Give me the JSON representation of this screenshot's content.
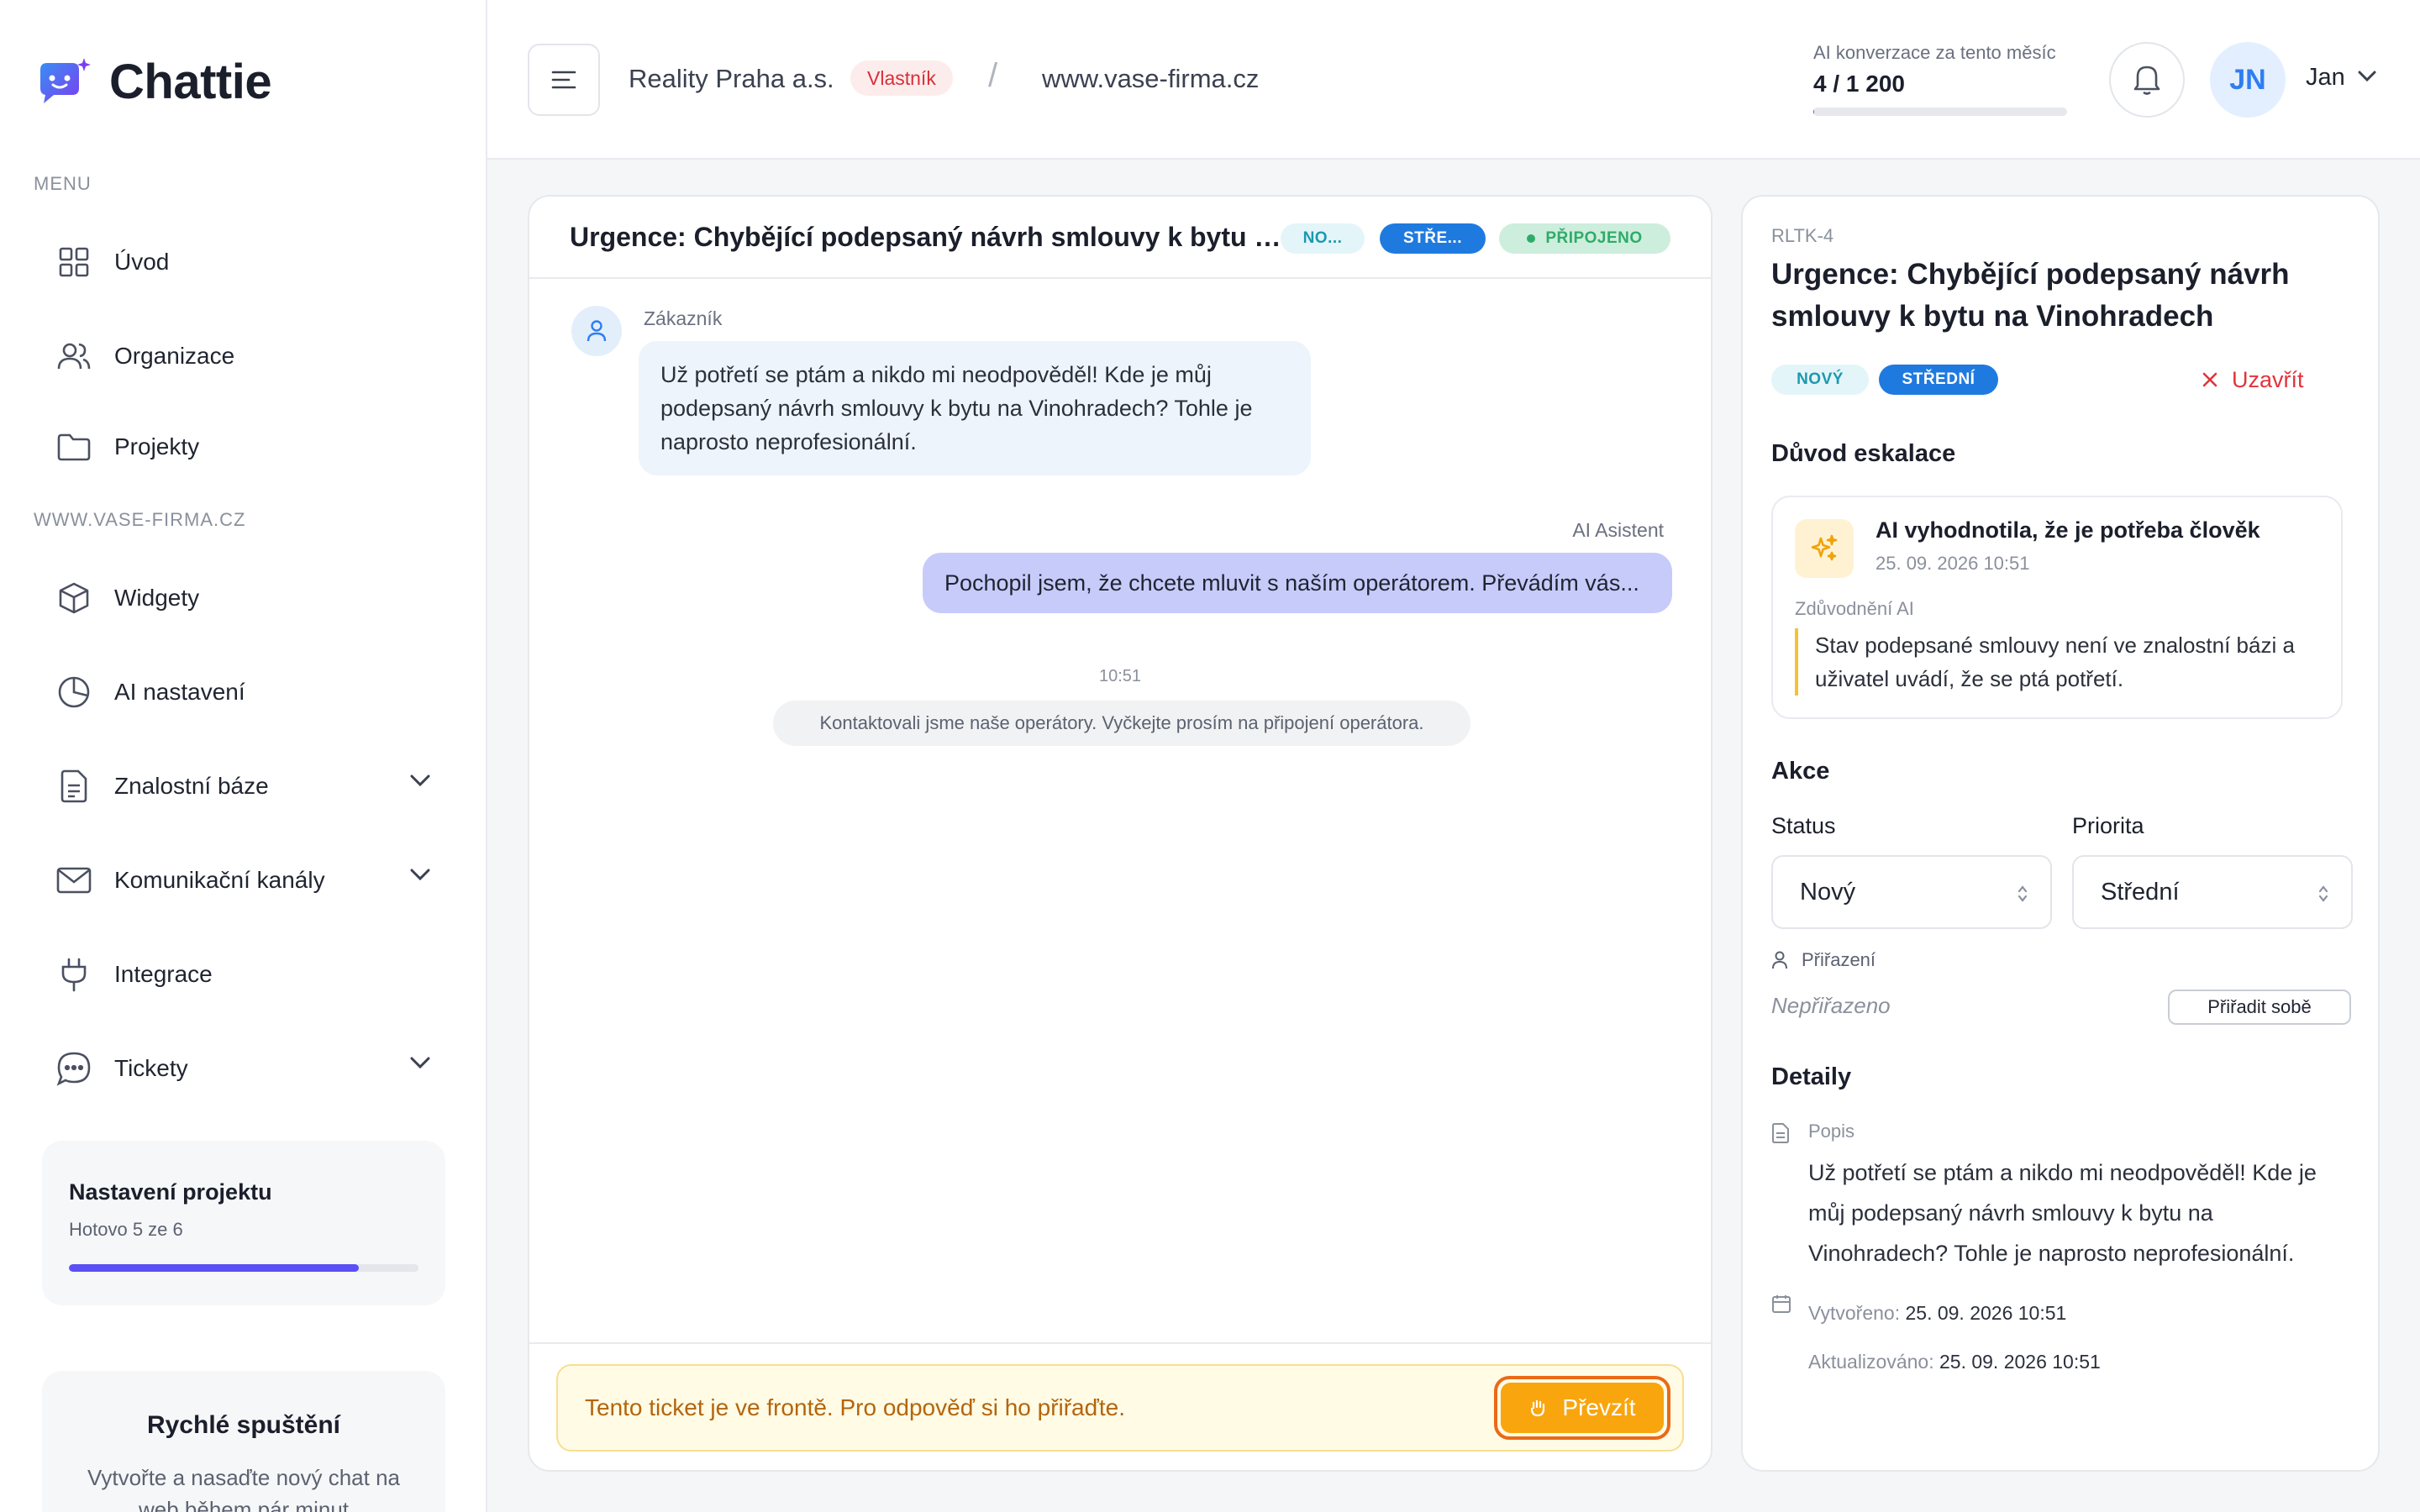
{
  "sidebar": {
    "brand": "Chattie",
    "menu_label": "MENU",
    "project_label": "WWW.VASE-FIRMA.CZ",
    "items": [
      {
        "label": "Úvod",
        "icon": "grid-icon"
      },
      {
        "label": "Organizace",
        "icon": "users-icon"
      },
      {
        "label": "Projekty",
        "icon": "folder-icon"
      }
    ],
    "project_items": [
      {
        "label": "Widgety",
        "icon": "cube-icon"
      },
      {
        "label": "AI nastavení",
        "icon": "pie-chart-icon"
      },
      {
        "label": "Znalostní báze",
        "icon": "document-icon"
      },
      {
        "label": "Komunikační kanály",
        "icon": "mail-icon"
      },
      {
        "label": "Integrace",
        "icon": "plug-icon"
      },
      {
        "label": "Tickety",
        "icon": "chat-bubble-icon"
      }
    ],
    "setup_card": {
      "title": "Nastavení projektu",
      "progress_text": "Hotovo 5 ze 6",
      "progress": 0.83
    },
    "quick_card": {
      "title": "Rychlé spuštění",
      "text": "Vytvořte a nasaďte nový chat na web během pár minut"
    }
  },
  "topbar": {
    "org_name": "Reality Praha a.s.",
    "role": "Vlastník",
    "separator": "/",
    "site": "www.vase-firma.cz",
    "usage_label": "AI konverzace za tento měsíc",
    "usage_value": "4 / 1 200",
    "usage_fraction": 0.0033,
    "avatar_initials": "JN",
    "user_name": "Jan"
  },
  "chat": {
    "title": "Urgence: Chybějící podepsaný návrh smlouvy k bytu na Vinohradech",
    "badges": {
      "status": "NO...",
      "priority": "STŘE...",
      "connection": "PŘIPOJENO"
    },
    "customer_name": "Zákazník",
    "customer_message": "Už potřetí se ptám a nikdo mi neodpověděl! Kde je můj podepsaný návrh smlouvy k bytu na Vinohradech? Tohle je naprosto neprofesionální.",
    "ai_name": "AI Asistent",
    "ai_message": "Pochopil jsem, že chcete mluvit s naším operátorem. Převádím vás...",
    "time": "10:51",
    "system_note": "Kontaktovali jsme naše operátory. Vyčkejte prosím na připojení operátora.",
    "queue_text": "Tento ticket je ve frontě. Pro odpověď si ho přiřaďte.",
    "takeover_label": "Převzít"
  },
  "detail": {
    "ticket_id": "RLTK-4",
    "title": "Urgence: Chybějící podepsaný návrh smlouvy k bytu na Vinohradech",
    "status_badge": "NOVÝ",
    "priority_badge": "STŘEDNÍ",
    "close_label": "Uzavřít",
    "escalation_heading": "Důvod eskalace",
    "escalation_title": "AI vyhodnotila, že je potřeba člověk",
    "escalation_time": "25. 09. 2026 10:51",
    "escalation_label": "Zdůvodnění AI",
    "escalation_text": "Stav podepsané smlouvy není ve znalostní bázi a uživatel uvádí, že se ptá potřetí.",
    "actions_heading": "Akce",
    "status_label": "Status",
    "status_value": "Nový",
    "priority_label": "Priorita",
    "priority_value": "Střední",
    "assign_label": "Přiřazení",
    "assign_value": "Nepřiřazeno",
    "assign_button": "Přiřadit sobě",
    "details_heading": "Detaily",
    "desc_label": "Popis",
    "desc_text": "Už potřetí se ptám a nikdo mi neodpověděl! Kde je můj podepsaný návrh smlouvy k bytu na Vinohradech? Tohle je naprosto neprofesionální.",
    "created_label": "Vytvořeno:",
    "created_value": "25. 09. 2026 10:51",
    "updated_label": "Aktualizováno:",
    "updated_value": "25. 09. 2026 10:51"
  },
  "colors": {
    "accent": "#5b4ff5",
    "ai_bubble": "#c7cbfa",
    "warning": "#f9a50e",
    "danger": "#e0343c",
    "priority": "#1f7ae0"
  }
}
